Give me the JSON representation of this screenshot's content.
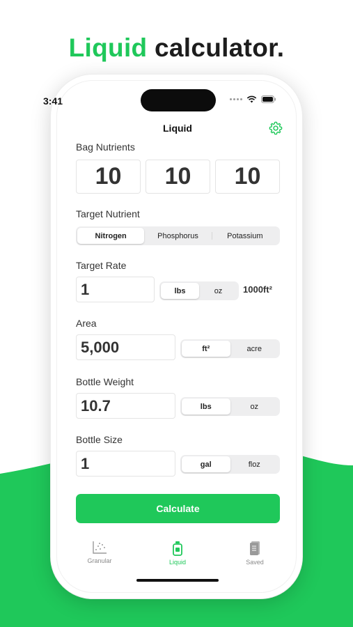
{
  "headline": {
    "accent": "Liquid",
    "rest": " calculator."
  },
  "status_bar": {
    "time": "3:41"
  },
  "nav": {
    "title": "Liquid"
  },
  "bag_nutrients": {
    "label": "Bag Nutrients",
    "values": [
      "10",
      "10",
      "10"
    ]
  },
  "target_nutrient": {
    "label": "Target Nutrient",
    "options": [
      "Nitrogen",
      "Phosphorus",
      "Potassium"
    ],
    "selected": "Nitrogen"
  },
  "target_rate": {
    "label": "Target Rate",
    "value": "1",
    "units": [
      "lbs",
      "oz"
    ],
    "selected": "lbs",
    "per": "1000ft²"
  },
  "area": {
    "label": "Area",
    "value": "5,000",
    "units": [
      "ft²",
      "acre"
    ],
    "selected": "ft²"
  },
  "bottle_weight": {
    "label": "Bottle Weight",
    "value": "10.7",
    "units": [
      "lbs",
      "oz"
    ],
    "selected": "lbs"
  },
  "bottle_size": {
    "label": "Bottle Size",
    "value": "1",
    "units": [
      "gal",
      "floz"
    ],
    "selected": "gal"
  },
  "calculate_label": "Calculate",
  "tabs": [
    {
      "label": "Granular",
      "icon": "scatter-chart-icon"
    },
    {
      "label": "Liquid",
      "icon": "bottle-icon"
    },
    {
      "label": "Saved",
      "icon": "notebook-icon"
    }
  ],
  "active_tab": "Liquid",
  "colors": {
    "accent": "#1fc85a",
    "text": "#1d1d1d",
    "field_border": "#e4e4e4",
    "segment_bg": "#eeeeef"
  }
}
